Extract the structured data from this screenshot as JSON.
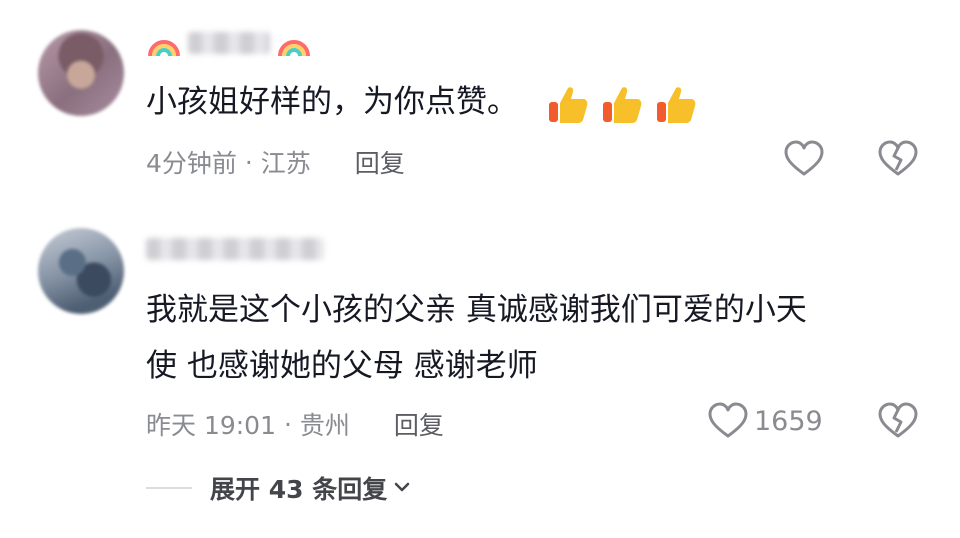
{
  "comments": [
    {
      "text": "小孩姐好样的，为你点赞。",
      "emojis": [
        "thumbs-up",
        "thumbs-up",
        "thumbs-up"
      ],
      "time": "4分钟前",
      "location": "江苏",
      "reply_label": "回复",
      "like_count": ""
    },
    {
      "text_line1": "我就是这个小孩的父亲  真诚感谢我们可爱的小天",
      "text_line2": "使  也感谢她的父母  感谢老师",
      "time": "昨天 19:01",
      "location": "贵州",
      "reply_label": "回复",
      "like_count": "1659"
    }
  ],
  "expand": {
    "label": "展开 43 条回复"
  },
  "colors": {
    "meta": "#8a8b91",
    "text": "#161823",
    "emoji": "#f7c02b"
  }
}
